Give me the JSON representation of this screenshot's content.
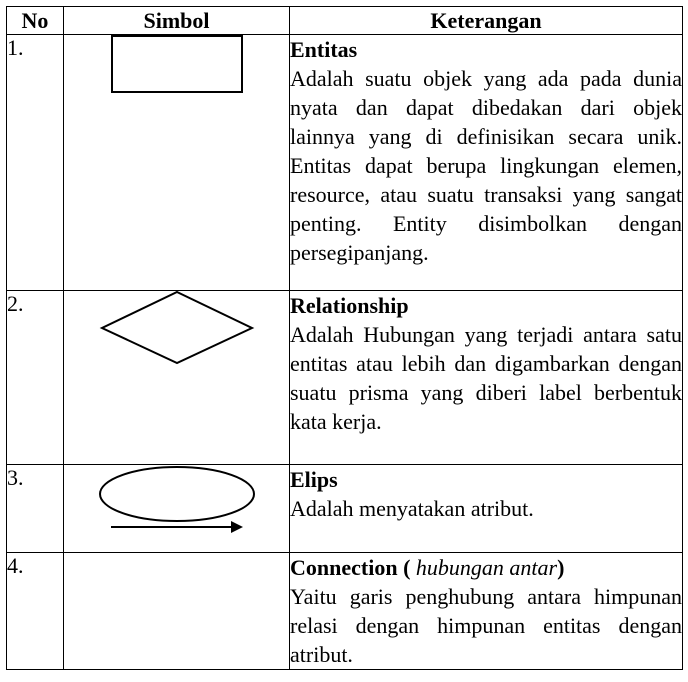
{
  "header": {
    "no": "No",
    "symbol": "Simbol",
    "description": "Keterangan"
  },
  "rows": [
    {
      "no": "1.",
      "symbol_icon": "rectangle-entity-icon",
      "title": "Entitas",
      "description": "Adalah suatu objek yang ada pada dunia nyata dan dapat dibedakan dari objek lainnya yang di definisikan secara unik. Entitas dapat berupa lingkungan elemen, resource, atau suatu transaksi yang sangat penting. Entity disimbolkan dengan persegipanjang."
    },
    {
      "no": "2.",
      "symbol_icon": "diamond-relationship-icon",
      "title": "Relationship",
      "description": "Adalah Hubungan yang terjadi antara satu entitas atau lebih dan digambarkan dengan suatu prisma yang diberi label berbentuk kata kerja."
    },
    {
      "no": "3.",
      "symbol_icon": "ellipse-attribute-icon",
      "title": "Elips",
      "description": "Adalah menyatakan atribut."
    },
    {
      "no": "4.",
      "symbol_icon": "arrow-connection-icon",
      "title": "Connection",
      "title_open": " ( ",
      "title_italic": "hubungan antar",
      "title_close": ")",
      "description": "Yaitu garis penghubung antara himpunan relasi dengan himpunan entitas dengan atribut."
    }
  ]
}
